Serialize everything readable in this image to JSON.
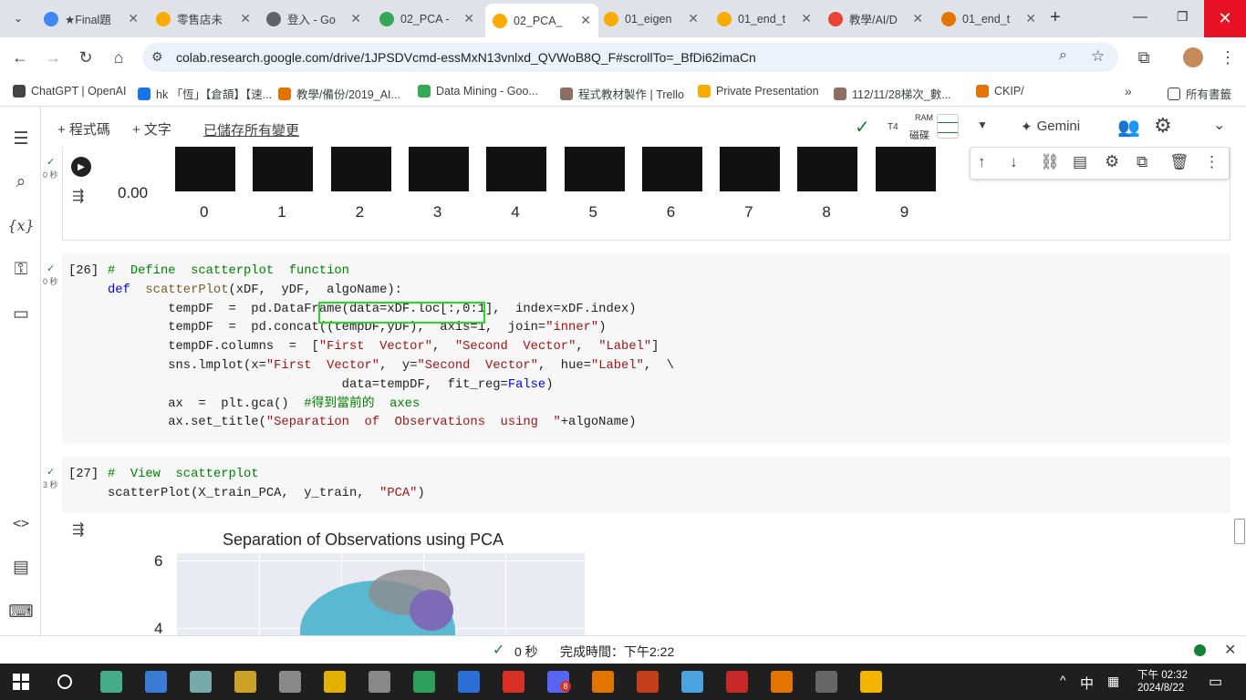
{
  "tabs": [
    {
      "title": "★Final題",
      "fav": "#4285f4"
    },
    {
      "title": "零售店未",
      "fav": "#f9ab00"
    },
    {
      "title": "登入 - Go",
      "fav": "#5f6368"
    },
    {
      "title": "02_PCA -",
      "fav": "#34a853"
    },
    {
      "title": "02_PCA_",
      "fav": "#f9ab00"
    },
    {
      "title": "01_eigen",
      "fav": "#f9ab00"
    },
    {
      "title": "01_end_t",
      "fav": "#f9ab00"
    },
    {
      "title": "教學/AI/D",
      "fav": "#ea4335"
    },
    {
      "title": "01_end_t",
      "fav": "#e37400"
    }
  ],
  "new_tab": "+",
  "url": "colab.research.google.com/drive/1JPSDVcmd-essMxN13vnlxd_QVWoB8Q_F#scrollTo=_BfDi62imaCn",
  "bookmarks": [
    {
      "label": "ChatGPT | OpenAI"
    },
    {
      "label": "hk 「恆」【倉頡】【速..."
    },
    {
      "label": "教學/備份/2019_AI..."
    },
    {
      "label": "Data Mining - Goo..."
    },
    {
      "label": "程式教材製作 | Trello"
    },
    {
      "label": "Private Presentation"
    },
    {
      "label": "112/11/28梯次_數..."
    },
    {
      "label": "CKIP/"
    }
  ],
  "all_bookmarks": "所有書籤",
  "colab": {
    "add_code": "+ 程式碼",
    "add_text": "+ 文字",
    "saved": "已儲存所有變更",
    "runtime": "T4",
    "ram": "RAM",
    "disk": "磁碟",
    "gemini": "Gemini"
  },
  "cell0": {
    "exec_time": "0 秒",
    "ytick": "0.00",
    "xticks": [
      "0",
      "1",
      "2",
      "3",
      "4",
      "5",
      "6",
      "7",
      "8",
      "9"
    ]
  },
  "cell1": {
    "prompt": "[26]",
    "exec_time": "0 秒"
  },
  "cell2": {
    "prompt": "[27]",
    "exec_time": "3 秒"
  },
  "plot": {
    "title": "Separation of Observations using PCA",
    "yticks": [
      "6",
      "4"
    ]
  },
  "status": {
    "check": "✓",
    "elapsed": "0 秒",
    "done": "完成時間：下午2:22"
  },
  "taskbar": {
    "ime": "中",
    "time": "下午 02:32",
    "date": "2024/8/22",
    "notif": "8"
  }
}
